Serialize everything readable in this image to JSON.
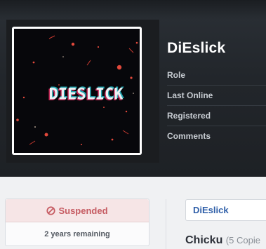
{
  "profile": {
    "username": "DiEslick",
    "avatar_text": "DIESLICK",
    "fields": [
      "Role",
      "Last Online",
      "Registered",
      "Comments"
    ]
  },
  "status": {
    "label": "Suspended",
    "remaining": "2 years remaining",
    "icon": "ban-icon",
    "color": "#c65c63"
  },
  "content": {
    "tab_label": "DiEslick",
    "item_title": "Chicku",
    "item_meta": "(5 Copie"
  }
}
